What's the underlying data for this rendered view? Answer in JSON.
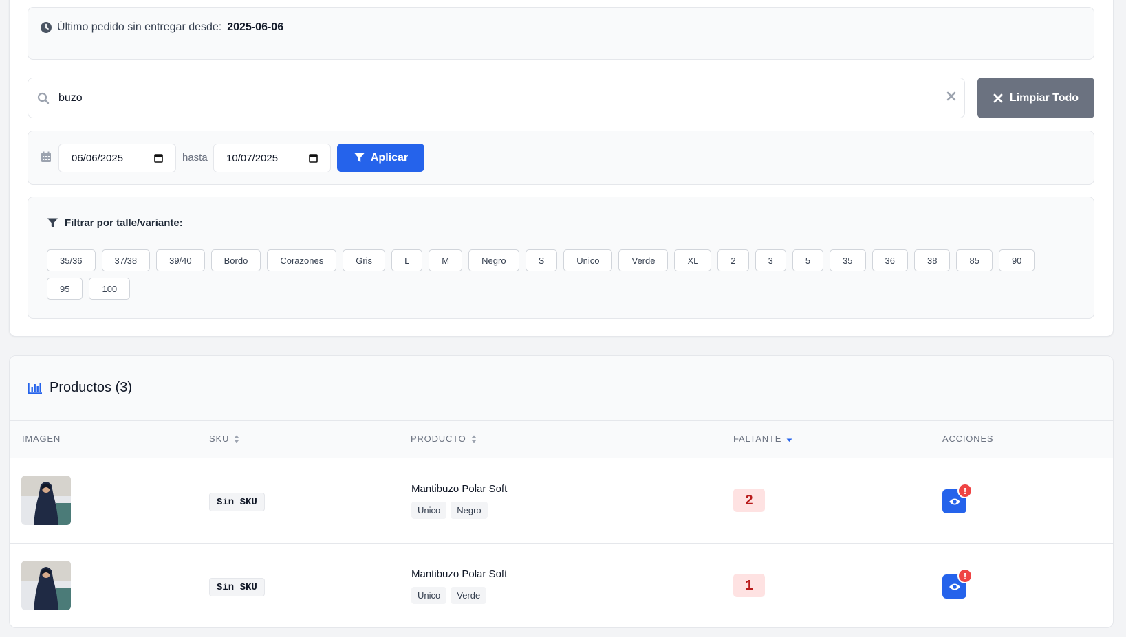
{
  "info": {
    "label": "Último pedido sin entregar desde:",
    "value": "2025-06-06"
  },
  "search": {
    "value": "buzo",
    "clear_all_label": "Limpiar Todo"
  },
  "dates": {
    "from": "06/06/2025",
    "separator": "hasta",
    "to": "10/07/2025",
    "apply_label": "Aplicar"
  },
  "filters": {
    "title": "Filtrar por talle/variante:",
    "chips": [
      "35/36",
      "37/38",
      "39/40",
      "Bordo",
      "Corazones",
      "Gris",
      "L",
      "M",
      "Negro",
      "S",
      "Unico",
      "Verde",
      "XL",
      "2",
      "3",
      "5",
      "35",
      "36",
      "38",
      "85",
      "90",
      "95",
      "100"
    ]
  },
  "products": {
    "title": "Productos (3)",
    "columns": {
      "image": "IMAGEN",
      "sku": "SKU",
      "product": "PRODUCTO",
      "missing": "FALTANTE",
      "actions": "ACCIONES"
    },
    "rows": [
      {
        "sku": "Sin SKU",
        "name": "Mantibuzo Polar Soft",
        "tags": [
          "Unico",
          "Negro"
        ],
        "missing": "2",
        "badge": "!"
      },
      {
        "sku": "Sin SKU",
        "name": "Mantibuzo Polar Soft",
        "tags": [
          "Unico",
          "Verde"
        ],
        "missing": "1",
        "badge": "!"
      }
    ]
  },
  "colors": {
    "primary": "#2563eb",
    "gray_button": "#6b7280",
    "danger": "#ef4444",
    "danger_bg": "#fee2e2"
  }
}
